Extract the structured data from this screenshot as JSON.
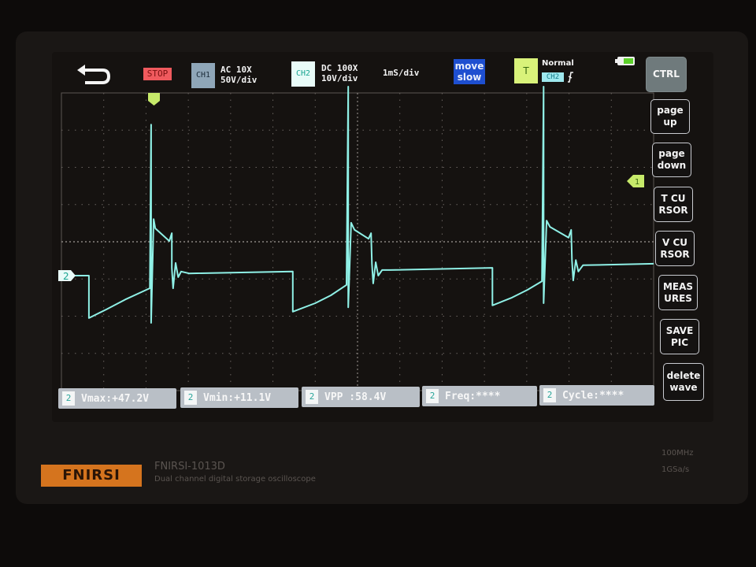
{
  "header": {
    "back_icon": "return-arrow-icon",
    "run_state": "STOP",
    "ch1": {
      "label": "CH1",
      "coupling": "AC 10X",
      "scale": "50V/div",
      "color": "#8fa6b8"
    },
    "ch2": {
      "label": "CH2",
      "coupling": "DC 100X",
      "scale": "10V/div",
      "color": "#c9f4f0"
    },
    "timebase": "1mS/div",
    "move_mode": [
      "move",
      "slow"
    ],
    "trigger": {
      "label": "T",
      "mode": "Normal",
      "source": "CH2",
      "edge_icon": "falling-edge-icon"
    },
    "battery_icon": "battery-icon"
  },
  "side_buttons": [
    {
      "label": "CTRL"
    },
    {
      "label": "page up"
    },
    {
      "label": "page down"
    },
    {
      "label": "T CU RSOR"
    },
    {
      "label": "V CU RSOR"
    },
    {
      "label": "MEAS URES"
    },
    {
      "label": "SAVE PIC"
    },
    {
      "label": "delete wave"
    }
  ],
  "measurements": [
    {
      "channel": "2",
      "text": "Vmax:+47.2V"
    },
    {
      "channel": "2",
      "text": "Vmin:+11.1V"
    },
    {
      "channel": "2",
      "text": "VPP :58.4V"
    },
    {
      "channel": "2",
      "text": "Freq:****"
    },
    {
      "channel": "2",
      "text": "Cycle:****"
    }
  ],
  "markers": {
    "ground": "2",
    "trigger_level": "1"
  },
  "chart_data": {
    "type": "line",
    "title": "",
    "xlabel": "",
    "ylabel": "",
    "x_unit": "ms",
    "y_unit": "V",
    "xlim": [
      0,
      14
    ],
    "ylim": [
      -30.9,
      49.1
    ],
    "grid": true,
    "grid_divisions": {
      "x": 14,
      "y": 8
    },
    "trace_color": "#8ff0e6",
    "series": [
      {
        "points": [
          [
            0,
            0
          ],
          [
            0.65,
            0
          ],
          [
            0.65,
            -11.4
          ],
          [
            1.06,
            -9.1
          ],
          [
            1.53,
            -6.3
          ],
          [
            2.05,
            -3.6
          ],
          [
            2.09,
            -3.4
          ],
          [
            2.12,
            40.6
          ],
          [
            2.12,
            -12.7
          ],
          [
            2.18,
            15.2
          ],
          [
            2.22,
            12.7
          ],
          [
            2.55,
            9.3
          ],
          [
            2.61,
            11.4
          ],
          [
            2.61,
            2.1
          ],
          [
            2.64,
            -3.4
          ],
          [
            2.7,
            3.4
          ],
          [
            2.76,
            -0.4
          ],
          [
            2.83,
            1.1
          ],
          [
            3.02,
            0.6
          ],
          [
            5.47,
            1.1
          ],
          [
            5.47,
            -9.7
          ],
          [
            6.0,
            -7.4
          ],
          [
            6.37,
            -5.3
          ],
          [
            6.74,
            -2.5
          ],
          [
            6.78,
            50.8
          ],
          [
            6.78,
            -8.5
          ],
          [
            6.85,
            14.2
          ],
          [
            6.93,
            12.3
          ],
          [
            7.26,
            9.9
          ],
          [
            7.32,
            11.4
          ],
          [
            7.34,
            3.2
          ],
          [
            7.37,
            -2.1
          ],
          [
            7.43,
            3.6
          ],
          [
            7.49,
            0
          ],
          [
            7.58,
            1.5
          ],
          [
            7.77,
            1.5
          ],
          [
            10.19,
            2.1
          ],
          [
            10.19,
            -8.0
          ],
          [
            10.65,
            -5.9
          ],
          [
            11.02,
            -3.8
          ],
          [
            11.36,
            -1.5
          ],
          [
            11.4,
            50.8
          ],
          [
            11.4,
            -7.4
          ],
          [
            11.47,
            14.8
          ],
          [
            11.55,
            13.1
          ],
          [
            11.99,
            10.2
          ],
          [
            12.05,
            12.3
          ],
          [
            12.07,
            4.2
          ],
          [
            12.1,
            -1.3
          ],
          [
            12.16,
            4.2
          ],
          [
            12.22,
            1.1
          ],
          [
            12.33,
            2.8
          ],
          [
            14.0,
            3.2
          ]
        ]
      }
    ]
  },
  "bezel": {
    "brand": "FNIRSI",
    "model": "FNIRSI-1013D",
    "description": "Dual channel digital storage oscilloscope",
    "bandwidth": "100MHz",
    "sample_rate": "1GSa/s"
  }
}
